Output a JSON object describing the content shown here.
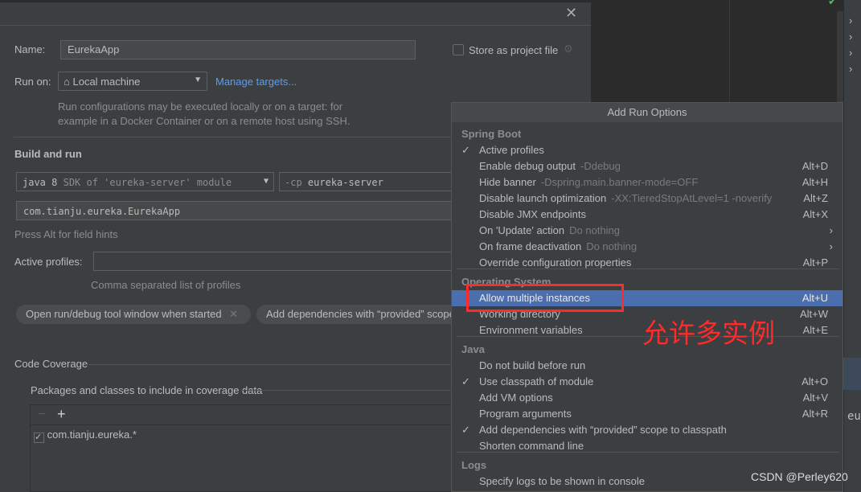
{
  "dialog": {
    "name_label": "Name:",
    "name_value": "EurekaApp",
    "store_label": "Store as project file",
    "run_on_label": "Run on:",
    "run_on_value": "Local machine",
    "manage_targets": "Manage targets...",
    "run_on_hint_1": "Run configurations may be executed locally or on a target: for",
    "run_on_hint_2": "example in a Docker Container or on a remote host using SSH.",
    "build_title": "Build and run",
    "sdk_main": "java 8",
    "sdk_sub": "SDK of 'eureka-server' module",
    "cp_prefix": "-cp",
    "cp_value": "eureka-server",
    "main_class": "com.tianju.eureka.EurekaApp",
    "field_hints": "Press Alt for field hints",
    "profiles_label": "Active profiles:",
    "profiles_value": "",
    "profiles_hint": "Comma separated list of profiles",
    "chips": [
      "Open run/debug tool window when started",
      "Add dependencies with “provided” scope"
    ],
    "coverage_title": "Code Coverage",
    "coverage_packages": "Packages and classes to include in coverage data",
    "coverage_items": [
      {
        "checked": true,
        "label": "com.tianju.eureka.*"
      }
    ]
  },
  "popup": {
    "title": "Add Run Options",
    "sections": [
      {
        "title": "Spring Boot",
        "items": [
          {
            "checked": true,
            "label": "Active profiles",
            "sub": "",
            "key": ""
          },
          {
            "checked": false,
            "label": "Enable debug output",
            "sub": "-Ddebug",
            "key": "Alt+D"
          },
          {
            "checked": false,
            "label": "Hide banner",
            "sub": "-Dspring.main.banner-mode=OFF",
            "key": "Alt+H"
          },
          {
            "checked": false,
            "label": "Disable launch optimization",
            "sub": "-XX:TieredStopAtLevel=1 -noverify",
            "key": "Alt+Z"
          },
          {
            "checked": false,
            "label": "Disable JMX endpoints",
            "sub": "",
            "key": "Alt+X"
          },
          {
            "checked": false,
            "label": "On 'Update' action",
            "sub": "Do nothing",
            "key": "",
            "submenu": true
          },
          {
            "checked": false,
            "label": "On frame deactivation",
            "sub": "Do nothing",
            "key": "",
            "submenu": true
          },
          {
            "checked": false,
            "label": "Override configuration properties",
            "sub": "",
            "key": "Alt+P"
          }
        ]
      },
      {
        "title": "Operating System",
        "items": [
          {
            "checked": false,
            "label": "Allow multiple instances",
            "sub": "",
            "key": "Alt+U",
            "selected": true
          },
          {
            "checked": false,
            "label": "Working directory",
            "sub": "",
            "key": "Alt+W"
          },
          {
            "checked": false,
            "label": "Environment variables",
            "sub": "",
            "key": "Alt+E"
          }
        ]
      },
      {
        "title": "Java",
        "items": [
          {
            "checked": false,
            "label": "Do not build before run",
            "sub": "",
            "key": ""
          },
          {
            "checked": true,
            "label": "Use classpath of module",
            "sub": "",
            "key": "Alt+O"
          },
          {
            "checked": false,
            "label": "Add VM options",
            "sub": "",
            "key": "Alt+V"
          },
          {
            "checked": false,
            "label": "Program arguments",
            "sub": "",
            "key": "Alt+R"
          },
          {
            "checked": true,
            "label": "Add dependencies with “provided” scope to classpath",
            "sub": "",
            "key": ""
          },
          {
            "checked": false,
            "label": "Shorten command line",
            "sub": "",
            "key": ""
          }
        ]
      },
      {
        "title": "Logs",
        "items": [
          {
            "checked": false,
            "label": "Specify logs to be shown in console",
            "sub": "",
            "key": ""
          }
        ]
      }
    ]
  },
  "annotation": {
    "text": "允许多实例",
    "color": "#ff2a2a"
  },
  "editor": {
    "fragment": "eu"
  },
  "watermark": "CSDN @Perley620",
  "colors": {
    "selection": "#4b6eaf",
    "link": "#589df6"
  }
}
